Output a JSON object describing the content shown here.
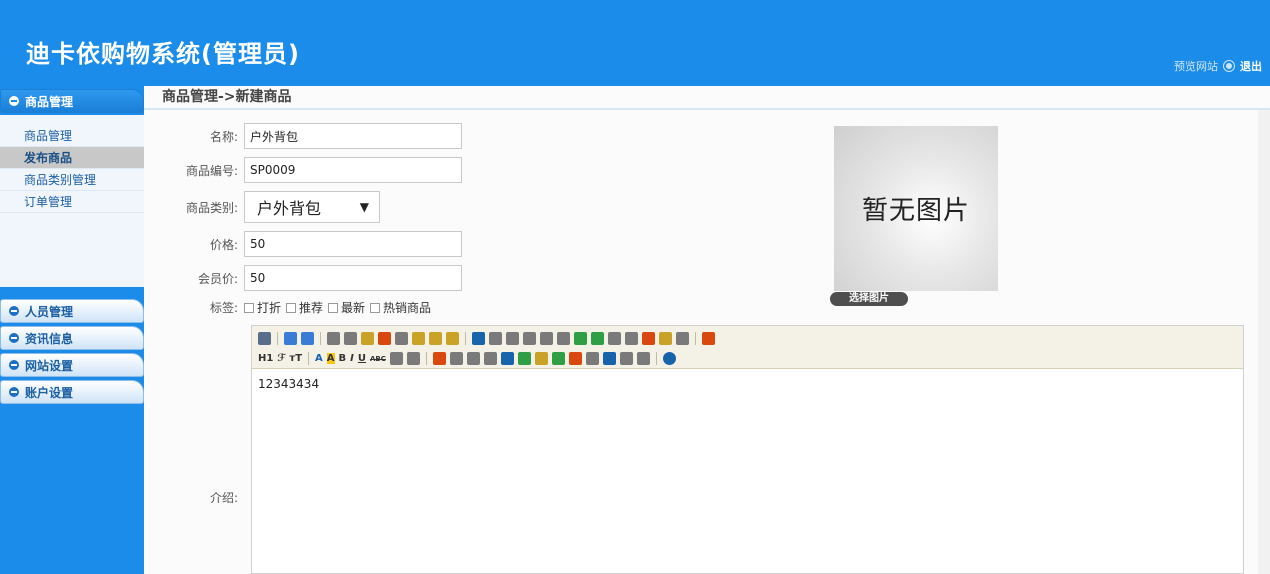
{
  "header": {
    "title": "迪卡依购物系统(管理员)",
    "preview_link": "预览网站",
    "logout": "退出"
  },
  "sidebar": {
    "sections": [
      {
        "label": "商品管理",
        "active": true
      },
      {
        "label": "人员管理"
      },
      {
        "label": "资讯信息"
      },
      {
        "label": "网站设置"
      },
      {
        "label": "账户设置"
      }
    ],
    "submenu": [
      {
        "label": "商品管理"
      },
      {
        "label": "发布商品",
        "selected": true
      },
      {
        "label": "商品类别管理"
      },
      {
        "label": "订单管理"
      }
    ]
  },
  "main": {
    "breadcrumb": "商品管理->新建商品",
    "form": {
      "name_label": "名称:",
      "name_value": "户外背包",
      "code_label": "商品编号:",
      "code_value": "SP0009",
      "category_label": "商品类别:",
      "category_value": "户外背包",
      "price_label": "价格:",
      "price_value": "50",
      "member_price_label": "会员价:",
      "member_price_value": "50",
      "tags_label": "标签:",
      "tags": [
        "打折",
        "推荐",
        "最新",
        "热销商品"
      ],
      "intro_label": "介绍:"
    },
    "image": {
      "placeholder": "暂无图片",
      "choose_button": "选择图片"
    },
    "editor": {
      "content": "12343434",
      "toolbar_text": [
        "H1",
        "ℱ",
        "тT",
        "A",
        "A",
        "B",
        "I",
        "U",
        "ABC"
      ]
    }
  }
}
